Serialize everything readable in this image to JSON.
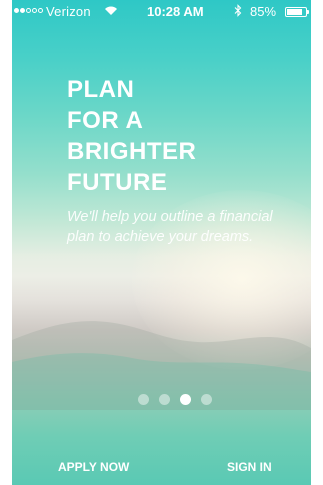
{
  "status_bar": {
    "carrier": "Verizon",
    "time": "10:28 AM",
    "battery_percent": "85%",
    "battery_level": 0.85,
    "signal_strength": 2,
    "signal_total": 5,
    "icons": [
      "wifi-icon",
      "bluetooth-icon",
      "battery-icon"
    ]
  },
  "onboarding": {
    "headline_lines": [
      "PLAN",
      "FOR A",
      "BRIGHTER",
      "FUTURE"
    ],
    "subtitle": "We'll help you outline a financial plan to achieve your dreams.",
    "page_count": 4,
    "active_page": 3
  },
  "actions": {
    "apply_label": "APPLY NOW",
    "signin_label": "SIGN IN"
  },
  "colors": {
    "top_teal": "#2ec8c6",
    "bottom_teal": "#5ac9b4",
    "text": "#ffffff"
  }
}
